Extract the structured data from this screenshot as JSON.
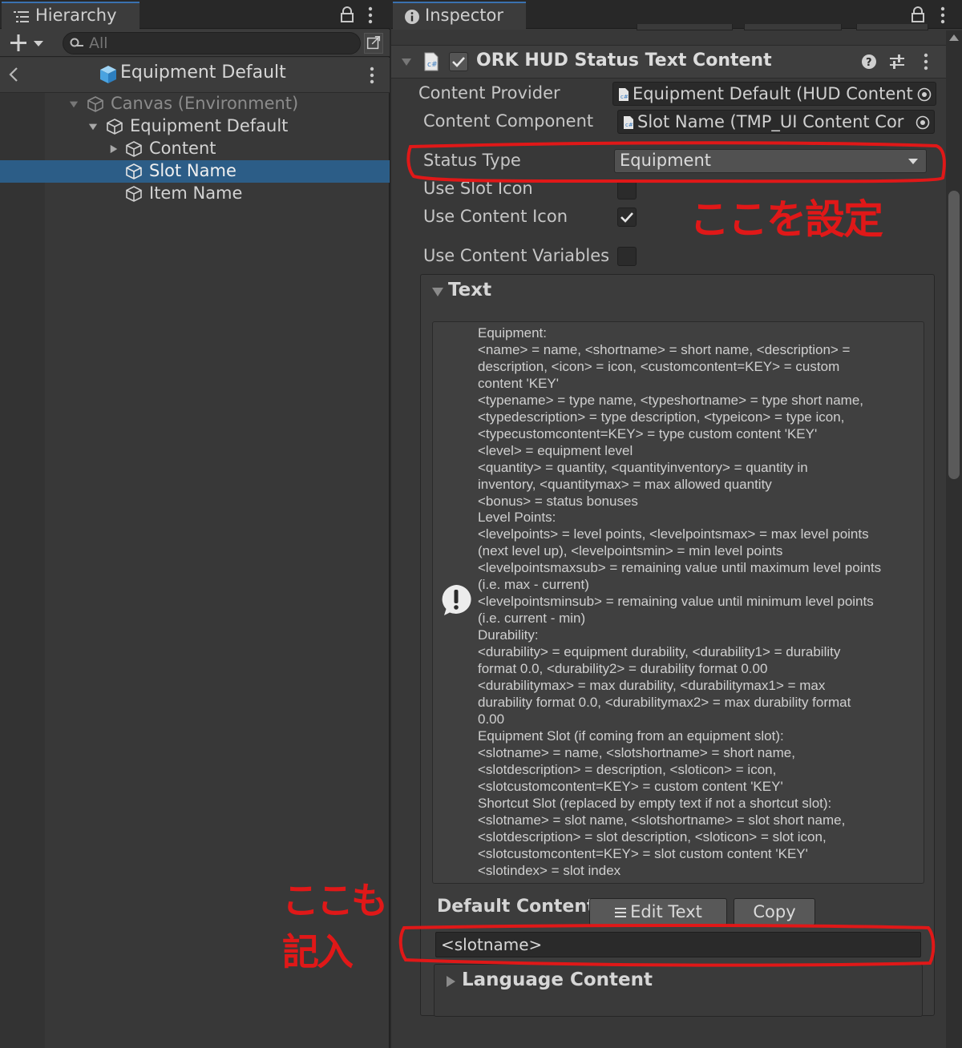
{
  "hierarchy": {
    "tab_label": "Hierarchy",
    "search_placeholder": "All",
    "scene_title": "Equipment Default",
    "tree": [
      {
        "label": "Canvas (Environment)",
        "depth": 0,
        "expanded": true,
        "dim": true
      },
      {
        "label": "Equipment Default",
        "depth": 1,
        "expanded": true,
        "dim": false
      },
      {
        "label": "Content",
        "depth": 2,
        "expanded": false,
        "dim": false
      },
      {
        "label": "Slot Name",
        "depth": 2,
        "selected": true,
        "dim": false
      },
      {
        "label": "Item Name",
        "depth": 2,
        "dim": false
      }
    ]
  },
  "inspector": {
    "tab_label": "Inspector",
    "component": {
      "title": "ORK HUD Status Text Content",
      "enabled": true
    },
    "content_provider": {
      "label": "Content Provider",
      "value": "Equipment Default (HUD Content"
    },
    "content_component": {
      "label": "Content Component",
      "value": "Slot Name (TMP_UI Content Cor"
    },
    "status_type": {
      "label": "Status Type",
      "value": "Equipment"
    },
    "use_slot_icon": {
      "label": "Use Slot Icon",
      "checked": false
    },
    "use_content_icon": {
      "label": "Use Content Icon",
      "checked": true
    },
    "use_content_variables": {
      "label": "Use Content Variables",
      "checked": false
    },
    "text_section": {
      "title": "Text",
      "help_lines": [
        "Equipment:",
        "<name> = name, <shortname> = short name, <description> =",
        "description, <icon> = icon, <customcontent=KEY> = custom",
        "content 'KEY'",
        "<typename> = type name, <typeshortname> = type short name,",
        "<typedescription> = type description, <typeicon> = type icon,",
        "<typecustomcontent=KEY> = type custom content 'KEY'",
        "<level> = equipment level",
        "<quantity> = quantity, <quantityinventory> = quantity in",
        "inventory, <quantitymax> = max allowed quantity",
        "<bonus> = status bonuses",
        "Level Points:",
        "<levelpoints> = level points, <levelpointsmax> = max level points",
        "(next level up), <levelpointsmin> = min level points",
        "<levelpointsmaxsub> = remaining value until maximum level points",
        "(i.e. max - current)",
        "<levelpointsminsub> = remaining value until minimum level points",
        "(i.e. current - min)",
        "Durability:",
        "<durability> = equipment durability, <durability1> = durability",
        "format 0.0, <durability2> = durability format 0.00",
        "<durabilitymax> = max durability, <durabilitymax1> = max",
        "durability format 0.0, <durabilitymax2> = max durability format",
        "0.00",
        "Equipment Slot (if coming from an equipment slot):",
        "<slotname> = name, <slotshortname> = short name,",
        "<slotdescription> = description, <sloticon> = icon,",
        "<slotcustomcontent=KEY> = custom content 'KEY'",
        "Shortcut Slot (replaced by empty text if not a shortcut slot):",
        "<slotname> = slot name, <slotshortname> = slot short name,",
        "<slotdescription> = slot description, <sloticon> = slot icon,",
        "<slotcustomcontent=KEY> = slot custom content 'KEY'",
        "<slotindex> = slot index"
      ],
      "default_content_label": "Default Content",
      "edit_text_label": "Edit Text",
      "copy_label": "Copy",
      "default_content_value": "<slotname>",
      "language_content_title": "Language Content"
    }
  },
  "annotations": {
    "note_1": "ここを設定",
    "note_2_line1": "ここも",
    "note_2_line2": "記入",
    "color": "#e01818"
  },
  "colors": {
    "selection": "#2c5d87",
    "tab_accent": "#3a72b0",
    "panel_bg": "#383838"
  }
}
